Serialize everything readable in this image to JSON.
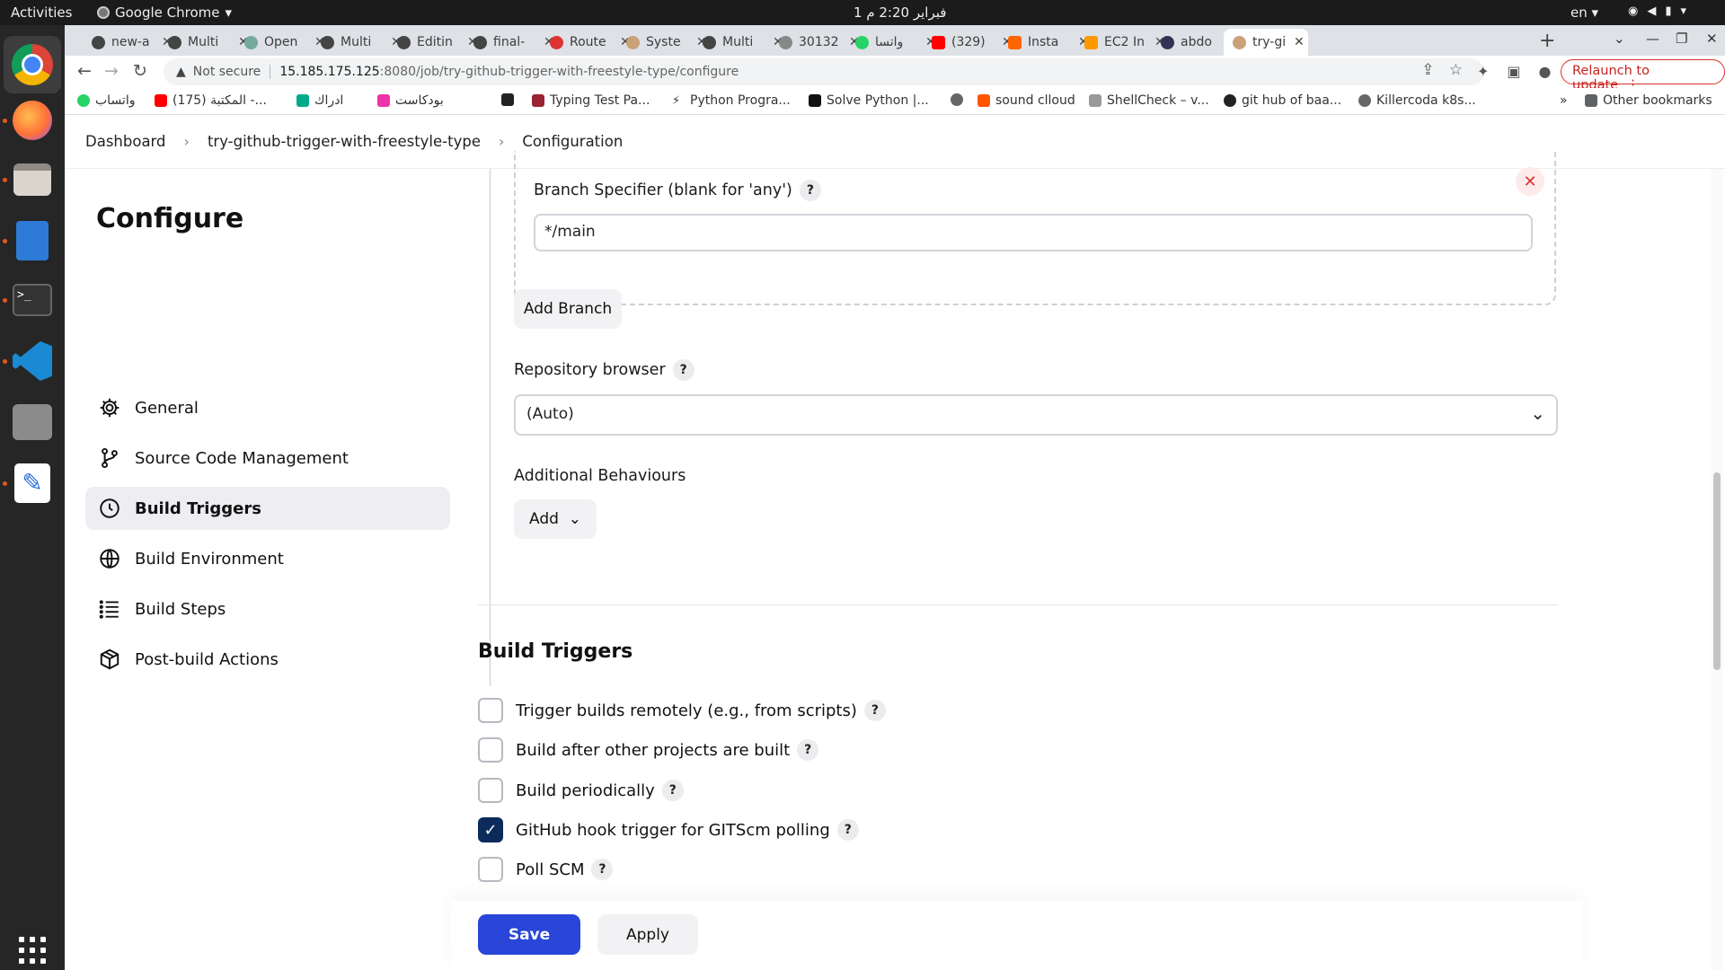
{
  "os": {
    "activities": "Activities",
    "app_name": "Google Chrome",
    "clock": "1 فبراير  2:20 م",
    "lang": "en"
  },
  "browser": {
    "tabs": [
      {
        "title": "new-a"
      },
      {
        "title": "Multi"
      },
      {
        "title": "Open"
      },
      {
        "title": "Multi"
      },
      {
        "title": "Editin"
      },
      {
        "title": "final-"
      },
      {
        "title": "Route"
      },
      {
        "title": "Syste"
      },
      {
        "title": "Multi"
      },
      {
        "title": "30132"
      },
      {
        "title": "واتسا"
      },
      {
        "title": "(329)"
      },
      {
        "title": "Insta"
      },
      {
        "title": "EC2 In"
      },
      {
        "title": "abdo"
      },
      {
        "title": "try-gi"
      }
    ],
    "security": "Not secure",
    "url_host": "15.185.175.125",
    "url_path": ":8080/job/try-github-trigger-with-freestyle-type/configure",
    "relaunch": "Relaunch to update",
    "bookmarks": [
      {
        "label": "واتساب"
      },
      {
        "label": "(175) المكتبة -..."
      },
      {
        "label": "ادراك"
      },
      {
        "label": "بودكاست"
      },
      {
        "label": ""
      },
      {
        "label": "Typing Test Pa..."
      },
      {
        "label": "Python Progra..."
      },
      {
        "label": "Solve Python |..."
      },
      {
        "label": ""
      },
      {
        "label": "sound clloud"
      },
      {
        "label": "ShellCheck – v..."
      },
      {
        "label": "git hub of baa..."
      },
      {
        "label": "Killercoda k8s..."
      }
    ],
    "bookmarks_more": "»",
    "other_bookmarks": "Other bookmarks"
  },
  "breadcrumbs": {
    "dashboard": "Dashboard",
    "job": "try-github-trigger-with-freestyle-type",
    "current": "Configuration"
  },
  "sidebar": {
    "title": "Configure",
    "items": [
      {
        "label": "General"
      },
      {
        "label": "Source Code Management"
      },
      {
        "label": "Build Triggers"
      },
      {
        "label": "Build Environment"
      },
      {
        "label": "Build Steps"
      },
      {
        "label": "Post-build Actions"
      }
    ]
  },
  "scm": {
    "branch_label": "Branch Specifier (blank for 'any')",
    "branch_value": "*/main",
    "add_branch": "Add Branch",
    "repo_browser_label": "Repository browser",
    "repo_browser_value": "(Auto)",
    "additional_label": "Additional Behaviours",
    "add_label": "Add"
  },
  "build_triggers": {
    "title": "Build Triggers",
    "options": [
      {
        "label": "Trigger builds remotely (e.g., from scripts)",
        "checked": false
      },
      {
        "label": "Build after other projects are built",
        "checked": false
      },
      {
        "label": "Build periodically",
        "checked": false
      },
      {
        "label": "GitHub hook trigger for GITScm polling",
        "checked": true
      },
      {
        "label": "Poll SCM",
        "checked": false
      }
    ]
  },
  "actions": {
    "save": "Save",
    "apply": "Apply"
  },
  "help_glyph": "?"
}
